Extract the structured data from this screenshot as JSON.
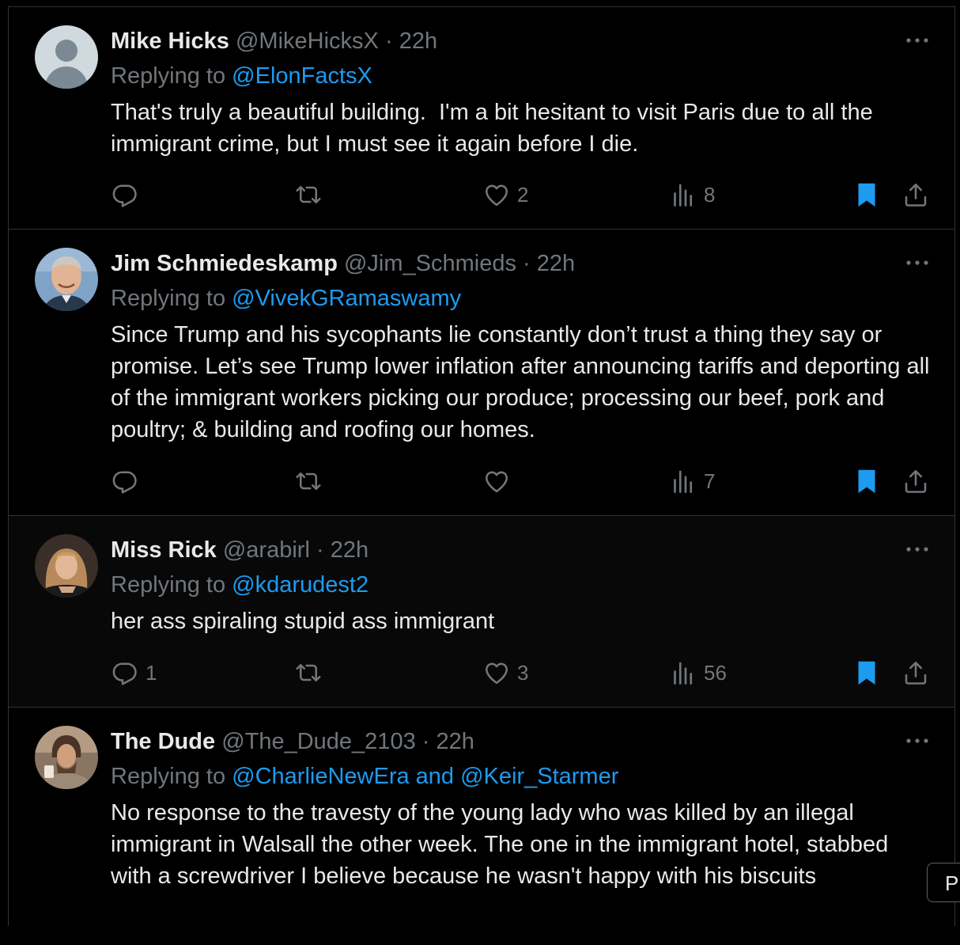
{
  "colors": {
    "background": "#000000",
    "text": "#e7e9ea",
    "muted": "#71767b",
    "link": "#1d9bf0",
    "divider": "#2f3336"
  },
  "icons": {
    "reply": "reply-icon",
    "retweet": "retweet-icon",
    "like": "heart-icon",
    "views": "views-icon",
    "bookmark": "bookmark-icon",
    "share": "share-icon",
    "more": "more-icon"
  },
  "tweets": [
    {
      "name": "Mike Hicks",
      "handle": "@MikeHicksX",
      "dot": "·",
      "time": "22h",
      "replying_label": "Replying to",
      "replying_to": "@ElonFactsX",
      "text": "That's truly a beautiful building.  I'm a bit hesitant to visit Paris due to all the immigrant crime, but I must see it again before I die.",
      "replies": "",
      "retweets": "",
      "likes": "2",
      "views": "8"
    },
    {
      "name": "Jim Schmiedeskamp",
      "handle": "@Jim_Schmieds",
      "dot": "·",
      "time": "22h",
      "replying_label": "Replying to",
      "replying_to": "@VivekGRamaswamy",
      "text": "Since Trump and his sycophants lie constantly don’t trust a thing they say or promise. Let’s see Trump lower inflation after announcing tariffs and deporting all of the immigrant workers picking our produce; processing our beef, pork and poultry; & building and roofing our homes.",
      "replies": "",
      "retweets": "",
      "likes": "",
      "views": "7"
    },
    {
      "name": "Miss Rick",
      "handle": "@arabirl",
      "dot": "·",
      "time": "22h",
      "replying_label": "Replying to",
      "replying_to": "@kdarudest2",
      "text": "her ass spiraling stupid ass immigrant",
      "replies": "1",
      "retweets": "",
      "likes": "3",
      "views": "56"
    },
    {
      "name": "The Dude",
      "handle": "@The_Dude_2103",
      "dot": "·",
      "time": "22h",
      "replying_label": "Replying to",
      "replying_to": "@CharlieNewEra and @Keir_Starmer",
      "text": "No response to the travesty of the young lady who was killed by an illegal immigrant in Walsall the other week. The one in the immigrant hotel, stabbed with a screwdriver I believe because he wasn't happy with his biscuits",
      "replies": "",
      "retweets": "",
      "likes": "",
      "views": ""
    }
  ],
  "side_button_label": "P"
}
